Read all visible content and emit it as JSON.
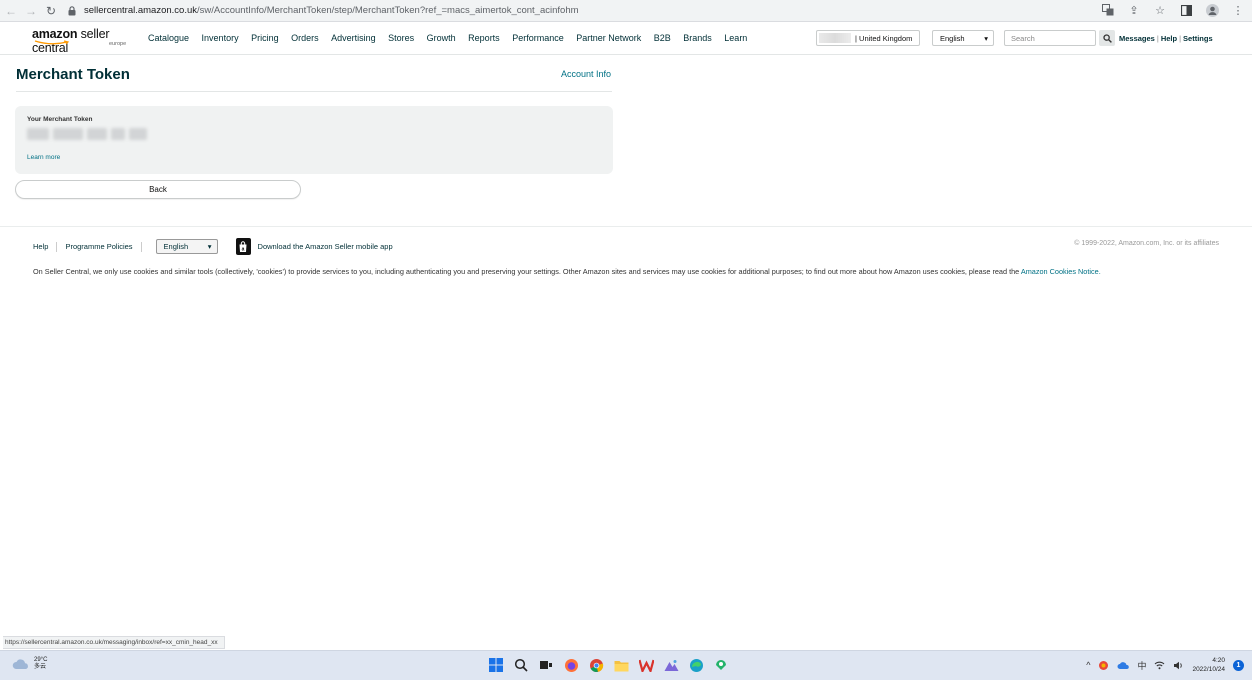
{
  "browser": {
    "url_host": "sellercentral.amazon.co.uk",
    "url_path": "/sw/AccountInfo/MerchantToken/step/MerchantToken?ref_=macs_aimertok_cont_acinfohm",
    "icons": [
      "back-arrow-icon",
      "forward-arrow-icon",
      "reload-icon",
      "lock-icon",
      "translate-icon",
      "share-icon",
      "star-icon",
      "sidebar-icon",
      "profile-icon",
      "menu-dots-icon"
    ]
  },
  "header": {
    "logo_bold": "amazon",
    "logo_rest": " seller central",
    "logo_region": "europe",
    "nav": [
      "Catalogue",
      "Inventory",
      "Pricing",
      "Orders",
      "Advertising",
      "Stores",
      "Growth",
      "Reports",
      "Performance",
      "Partner Network",
      "B2B",
      "Brands",
      "Learn"
    ],
    "country": "| United Kingdom",
    "language": "English",
    "search_placeholder": "Search",
    "links": {
      "messages": "Messages",
      "help": "Help",
      "settings": "Settings"
    }
  },
  "main": {
    "title": "Merchant Token",
    "account_info": "Account Info",
    "token_label": "Your Merchant Token",
    "learn_more": "Learn more",
    "back": "Back"
  },
  "footer": {
    "help": "Help",
    "policies": "Programme Policies",
    "language": "English",
    "app_text": "Download the Amazon Seller mobile app",
    "copyright": "© 1999-2022, Amazon.com, Inc. or its affiliates",
    "cookie_text": "On Seller Central, we only use cookies and similar tools (collectively, 'cookies') to provide services to you, including authenticating you and preserving your settings. Other Amazon sites and services may use cookies for additional purposes; to find out more about how Amazon uses cookies, please read the ",
    "cookie_link": "Amazon Cookies Notice."
  },
  "status_url": "https://sellercentral.amazon.co.uk/messaging/inbox/ref=xx_cmin_head_xx",
  "taskbar": {
    "temperature": "29°C",
    "weather": "多云",
    "ime": "中",
    "time": "4:20",
    "date": "2022/10/24",
    "notifications": "1"
  },
  "colors": {
    "link": "#007185",
    "title": "#002f36",
    "card": "#f0f2f2",
    "taskbar": "#dfe6f2"
  }
}
